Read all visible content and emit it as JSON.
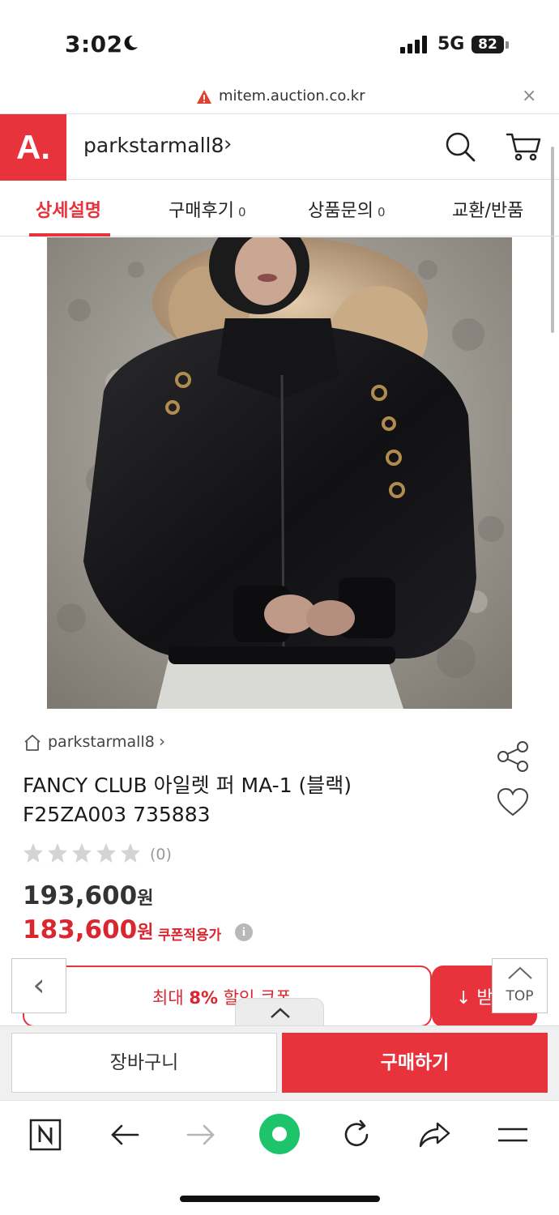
{
  "status_bar": {
    "time": "3:02",
    "network": "5G",
    "battery": "82"
  },
  "url_bar": {
    "url": "mitem.auction.co.kr",
    "close_label": "×"
  },
  "header": {
    "logo_text": "A.",
    "shop_name": "parkstarmall8",
    "brand_color": "#e8323c"
  },
  "tabs": [
    {
      "label": "상세설명",
      "count": ""
    },
    {
      "label": "구매후기",
      "count": "0"
    },
    {
      "label": "상품문의",
      "count": "0"
    },
    {
      "label": "교환/반품",
      "count": ""
    }
  ],
  "product": {
    "store_name": "parkstarmall8",
    "title_line1": "FANCY CLUB 아일렛 퍼 MA-1 (블랙)",
    "title_line2": "F25ZA003 735883",
    "rating": 0,
    "review_count": "(0)",
    "original_price": "193,600",
    "sale_price": "183,600",
    "currency": "원",
    "coupon_price_label": "쿠폰적용가",
    "info_icon": "i"
  },
  "coupon": {
    "text_prefix": "최대",
    "text_rate": "8%",
    "text_suffix": "할인 쿠폰",
    "download_label": "↓ 받"
  },
  "floating": {
    "back_label": "‹",
    "top_label": "TOP"
  },
  "actions": {
    "cart_label": "장바구니",
    "buy_label": "구매하기"
  },
  "browser_toolbar": {
    "items": [
      "n-icon",
      "back-arrow-icon",
      "forward-arrow-icon",
      "green-dot-icon",
      "refresh-icon",
      "share-icon",
      "menu-icon"
    ]
  }
}
